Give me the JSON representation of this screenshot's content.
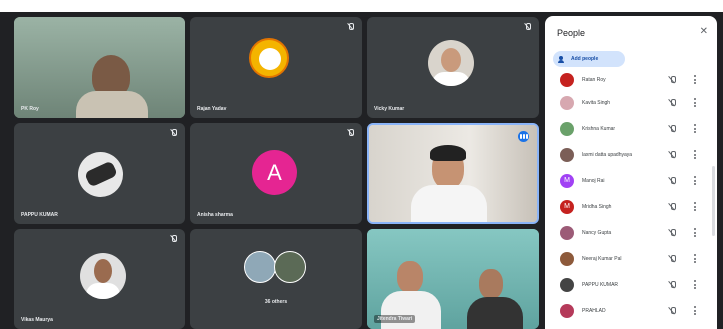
{
  "tiles": {
    "t1": {
      "name": "PK Roy"
    },
    "t2": {
      "name": "Rajan Yadav"
    },
    "t3": {
      "name": "Vicky Kumar"
    },
    "t4": {
      "name": "PAPPU KUMAR"
    },
    "t5": {
      "name": "Anisha sharma",
      "initial": "A"
    },
    "t6": {
      "name": ""
    },
    "t7": {
      "name": "Vikas Maurya"
    },
    "t8": {
      "name": "36 others"
    },
    "t9": {
      "name": "Jitendra Tiwari"
    }
  },
  "panel": {
    "title": "People",
    "add_label": "Add people",
    "close": "✕",
    "participants": [
      {
        "name": "Ratan Roy",
        "color": "#c5221f",
        "initial": ""
      },
      {
        "name": "Kavita Singh",
        "color": "#d7a8b0",
        "initial": ""
      },
      {
        "name": "Krishna Kumar",
        "color": "#6aa16a",
        "initial": ""
      },
      {
        "name": "laxmi datta upadhyaya",
        "color": "#7b5e57",
        "initial": ""
      },
      {
        "name": "Manoj Rai",
        "color": "#a142f4",
        "initial": "M"
      },
      {
        "name": "Mridha Singh",
        "color": "#c5221f",
        "initial": "M"
      },
      {
        "name": "Nancy Gupta",
        "color": "#9c5b77",
        "initial": ""
      },
      {
        "name": "Neeraj Kumar Pal",
        "color": "#8d5a3b",
        "initial": ""
      },
      {
        "name": "PAPPU KUMAR",
        "color": "#444444",
        "initial": ""
      },
      {
        "name": "PRAHLAD",
        "color": "#b53a5a",
        "initial": ""
      }
    ]
  },
  "colors": {
    "bg": "#202124",
    "tile": "#3c4043",
    "accent": "#1a73e8",
    "anisha_avatar": "#e52592"
  }
}
